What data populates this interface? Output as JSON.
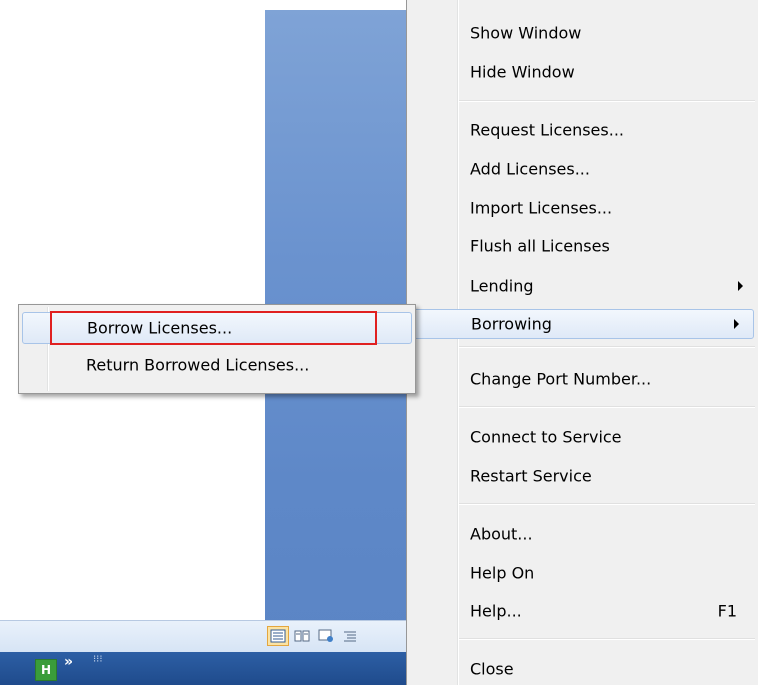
{
  "main_menu": {
    "items": [
      {
        "label": "Show Window"
      },
      {
        "label": "Hide Window"
      },
      {
        "label": "Request Licenses..."
      },
      {
        "label": "Add Licenses..."
      },
      {
        "label": "Import Licenses..."
      },
      {
        "label": "Flush all Licenses"
      },
      {
        "label": "Lending",
        "has_submenu": true
      },
      {
        "label": "Borrowing",
        "has_submenu": true,
        "highlighted": true
      },
      {
        "label": "Change Port Number..."
      },
      {
        "label": "Connect to Service"
      },
      {
        "label": "Restart Service"
      },
      {
        "label": "About..."
      },
      {
        "label": "Help On"
      },
      {
        "label": "Help...",
        "shortcut": "F1"
      },
      {
        "label": "Close"
      }
    ]
  },
  "submenu": {
    "items": [
      {
        "label": "Borrow Licenses...",
        "highlighted": true,
        "callout_color": "#e02020"
      },
      {
        "label": "Return Borrowed Licenses..."
      }
    ]
  },
  "taskbar": {
    "app_glyph": "H",
    "overflow": "»"
  },
  "colors": {
    "menu_bg": "#f0f0f0",
    "highlight_border": "#a8c4e8",
    "callout": "#e02020",
    "window_blue": "#6b93cf",
    "taskbar_blue": "#1f4b8c"
  },
  "icons": [
    "view-normal-icon",
    "view-reading-icon",
    "view-web-icon",
    "view-outline-icon",
    "submenu-arrow-icon"
  ]
}
